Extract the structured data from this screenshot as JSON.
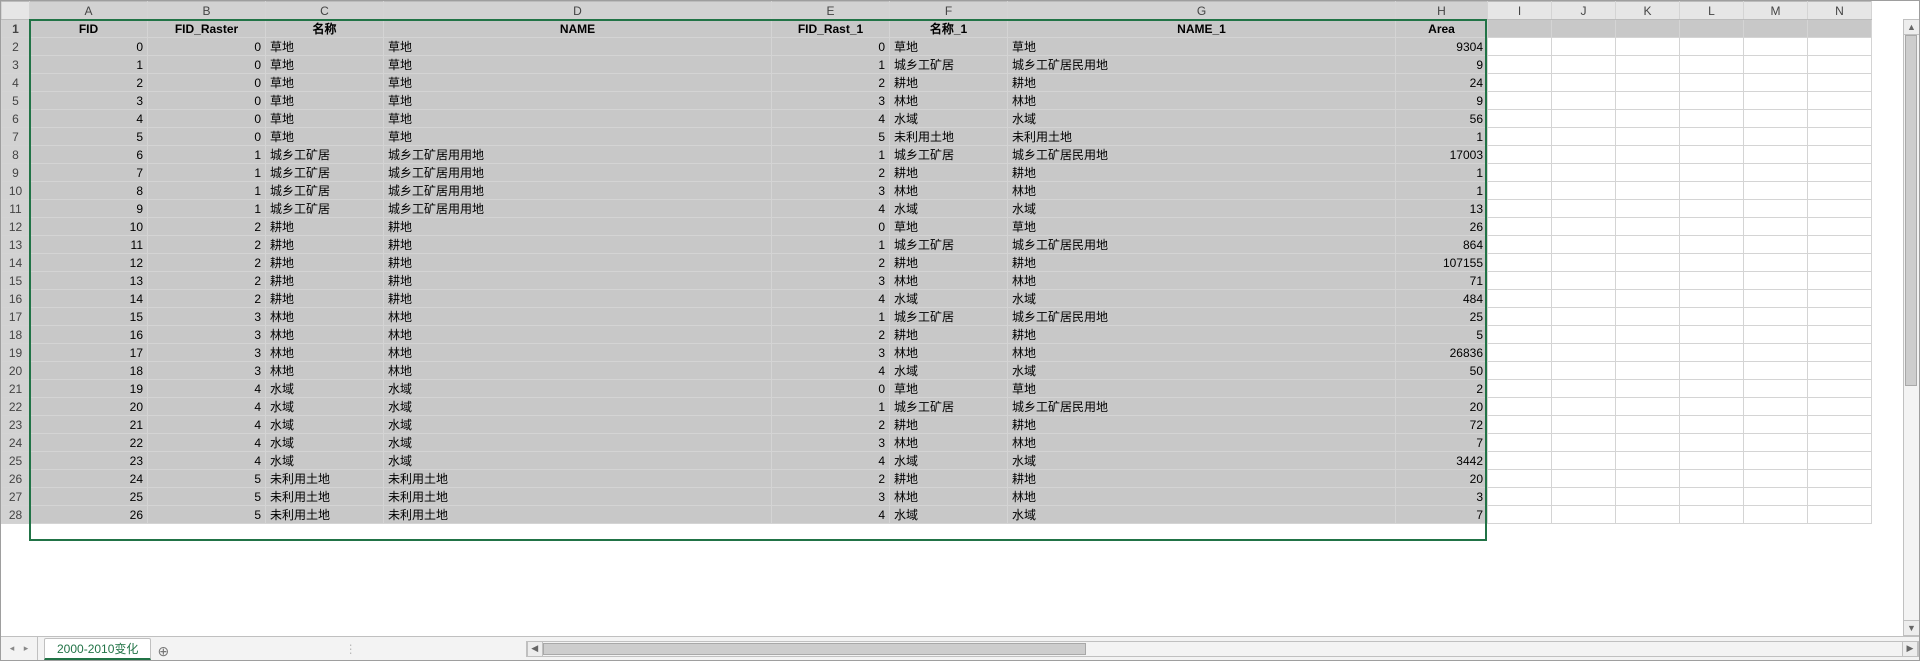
{
  "sheet": {
    "active_tab": "2000-2010变化",
    "columns_letters": [
      "A",
      "B",
      "C",
      "D",
      "E",
      "F",
      "G",
      "H",
      "I",
      "J",
      "K",
      "L",
      "M",
      "N"
    ],
    "selected_col_letters": [
      "A",
      "B",
      "C",
      "D",
      "E",
      "F",
      "G",
      "H"
    ],
    "visible_row_numbers": [
      1,
      2,
      3,
      4,
      5,
      6,
      7,
      8,
      9,
      10,
      11,
      12,
      13,
      14,
      15,
      16,
      17,
      18,
      19,
      20,
      21,
      22,
      23,
      24,
      25,
      26,
      27,
      28
    ],
    "header_row": [
      "FID",
      "FID_Raster",
      "名称",
      "NAME",
      "FID_Rast_1",
      "名称_1",
      "NAME_1",
      "Area"
    ],
    "rows": [
      [
        0,
        0,
        "草地",
        "草地",
        0,
        "草地",
        "草地",
        9304
      ],
      [
        1,
        0,
        "草地",
        "草地",
        1,
        "城乡工矿居",
        "城乡工矿居民用地",
        9
      ],
      [
        2,
        0,
        "草地",
        "草地",
        2,
        "耕地",
        "耕地",
        24
      ],
      [
        3,
        0,
        "草地",
        "草地",
        3,
        "林地",
        "林地",
        9
      ],
      [
        4,
        0,
        "草地",
        "草地",
        4,
        "水域",
        "水域",
        56
      ],
      [
        5,
        0,
        "草地",
        "草地",
        5,
        "未利用土地",
        "未利用土地",
        1
      ],
      [
        6,
        1,
        "城乡工矿居",
        "城乡工矿居用用地",
        1,
        "城乡工矿居",
        "城乡工矿居民用地",
        17003
      ],
      [
        7,
        1,
        "城乡工矿居",
        "城乡工矿居用用地",
        2,
        "耕地",
        "耕地",
        1
      ],
      [
        8,
        1,
        "城乡工矿居",
        "城乡工矿居用用地",
        3,
        "林地",
        "林地",
        1
      ],
      [
        9,
        1,
        "城乡工矿居",
        "城乡工矿居用用地",
        4,
        "水域",
        "水域",
        13
      ],
      [
        10,
        2,
        "耕地",
        "耕地",
        0,
        "草地",
        "草地",
        26
      ],
      [
        11,
        2,
        "耕地",
        "耕地",
        1,
        "城乡工矿居",
        "城乡工矿居民用地",
        864
      ],
      [
        12,
        2,
        "耕地",
        "耕地",
        2,
        "耕地",
        "耕地",
        107155
      ],
      [
        13,
        2,
        "耕地",
        "耕地",
        3,
        "林地",
        "林地",
        71
      ],
      [
        14,
        2,
        "耕地",
        "耕地",
        4,
        "水域",
        "水域",
        484
      ],
      [
        15,
        3,
        "林地",
        "林地",
        1,
        "城乡工矿居",
        "城乡工矿居民用地",
        25
      ],
      [
        16,
        3,
        "林地",
        "林地",
        2,
        "耕地",
        "耕地",
        5
      ],
      [
        17,
        3,
        "林地",
        "林地",
        3,
        "林地",
        "林地",
        26836
      ],
      [
        18,
        3,
        "林地",
        "林地",
        4,
        "水域",
        "水域",
        50
      ],
      [
        19,
        4,
        "水域",
        "水域",
        0,
        "草地",
        "草地",
        2
      ],
      [
        20,
        4,
        "水域",
        "水域",
        1,
        "城乡工矿居",
        "城乡工矿居民用地",
        20
      ],
      [
        21,
        4,
        "水域",
        "水域",
        2,
        "耕地",
        "耕地",
        72
      ],
      [
        22,
        4,
        "水域",
        "水域",
        3,
        "林地",
        "林地",
        7
      ],
      [
        23,
        4,
        "水域",
        "水域",
        4,
        "水域",
        "水域",
        3442
      ],
      [
        24,
        5,
        "未利用土地",
        "未利用土地",
        2,
        "耕地",
        "耕地",
        20
      ],
      [
        25,
        5,
        "未利用土地",
        "未利用土地",
        3,
        "林地",
        "林地",
        3
      ],
      [
        26,
        5,
        "未利用土地",
        "未利用土地",
        4,
        "水域",
        "水域",
        7
      ]
    ],
    "column_alignments": [
      "num",
      "num",
      "txt",
      "txt",
      "num",
      "txt",
      "txt",
      "num"
    ]
  },
  "icons": {
    "nav_prev": "◂",
    "nav_next": "▸",
    "new_sheet": "⊕",
    "split_dots": "⋮",
    "arrow_left": "◀",
    "arrow_right": "▶",
    "arrow_up": "▲",
    "arrow_down": "▼"
  }
}
